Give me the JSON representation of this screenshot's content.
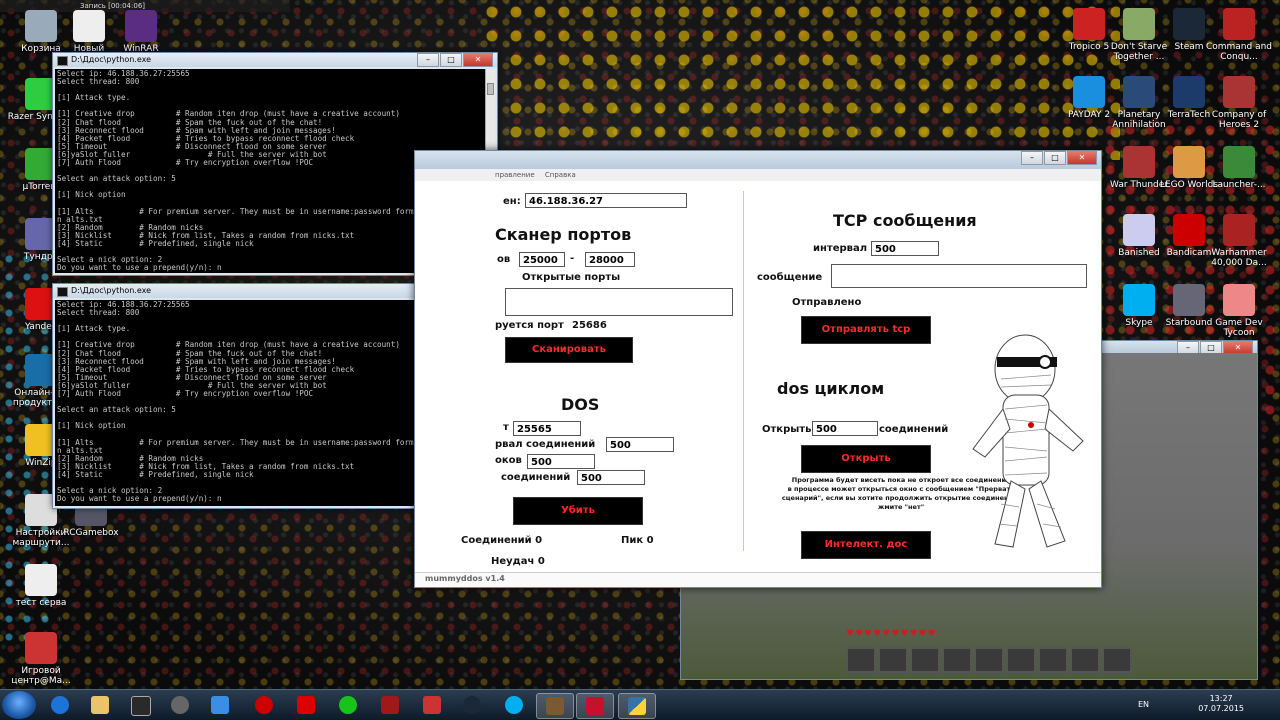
{
  "top_bar": {
    "recording_label": "Запись [00:04:06]"
  },
  "desktop_left_icons": [
    {
      "label": "Корзина"
    },
    {
      "label": "Новый"
    },
    {
      "label": "WinRAR"
    },
    {
      "label": "Razer Synapse"
    },
    {
      "label": "µTorrent"
    },
    {
      "label": "Тундра"
    },
    {
      "label": "Yandex"
    },
    {
      "label": "Онлайн-р... продукта ..."
    },
    {
      "label": "WinZip"
    },
    {
      "label": "Настройки маршрути..."
    },
    {
      "label": "RCGamebox"
    },
    {
      "label": "тест серва"
    },
    {
      "label": "Игровой центр@Ma..."
    }
  ],
  "desktop_right_icons": [
    {
      "label": "Tropico 5"
    },
    {
      "label": "Don't Starve Together ..."
    },
    {
      "label": "Steam"
    },
    {
      "label": "Command and Conqu..."
    },
    {
      "label": "PAYDAY 2"
    },
    {
      "label": "Planetary Annihilation"
    },
    {
      "label": "TerraTech"
    },
    {
      "label": "Company of Heroes 2"
    },
    {
      "label": "War Thunder"
    },
    {
      "label": "LEGO Worlds"
    },
    {
      "label": "Launcher-..."
    },
    {
      "label": "Banished"
    },
    {
      "label": "Bandicam"
    },
    {
      "label": "Warhammer 40,000 Da..."
    },
    {
      "label": "Skype"
    },
    {
      "label": "Starbound"
    },
    {
      "label": "Game Dev Tycoon"
    }
  ],
  "console1": {
    "title": "D:\\Ддос\\python.exe",
    "text": "Select ip: 46.188.36.27:25565\nSelect thread: 800\n\n[i] Attack type.\n\n[1] Creative drop         # Random iten drop (must have a creative account)\n[2] Chat flood            # Spam the fuck out of the chat!\n[3] Reconnect flood       # Spam with left and join messages!\n[4] Packet flood          # Tries to bypass reconnect flood check\n[5] Timeout               # Disconnect flood on some server\n[6]уaSlot fuller                 # Full the server with bot\n[7] Auth Flood            # Try encryption overflow !POC\n\nSelect an attack option: 5\n\n[i] Nick option\n\n[1] Alts          # For premium server. They must be in username:password format i\nn alts.txt\n[2] Random        # Random nicks\n[3] Nicklist      # Nick from list, Takes a random from nicks.txt\n[4] Static        # Predefined, single nick\n\nSelect a nick option: 2\nDo you want to use a prepend(y/n): n"
  },
  "console2": {
    "title": "D:\\Ддос\\python.exe",
    "text": "Select ip: 46.188.36.27:25565\nSelect thread: 800\n\n[i] Attack type.\n\n[1] Creative drop         # Random iten drop (must have a creative account)\n[2] Chat flood            # Spam the fuck out of the chat!\n[3] Reconnect flood       # Spam with left and join messages!\n[4] Packet flood          # Tries to bypass reconnect flood check\n[5] Timeout               # Disconnect flood on some server\n[6]уaSlot fuller                 # Full the server with bot\n[7] Auth Flood            # Try encryption overflow !POC\n\nSelect an attack option: 5\n\n[i] Nick option\n\n[1] Alts          # For premium server. They must be in username:password format i\nn alts.txt\n[2] Random        # Random nicks\n[3] Nicklist      # Nick from list, Takes a random from nicks.txt\n[4] Static        # Predefined, single nick\n\nSelect a nick option: 2\nDo you want to use a prepend(y/n): n"
  },
  "app": {
    "menu": [
      "правление",
      "Справка"
    ],
    "ip_label": "ен:",
    "ip_value": "46.188.36.27",
    "scanner_title": "Сканер портов",
    "range_label": "ов",
    "range_from": "25000",
    "range_dash": "-",
    "range_to": "28000",
    "open_ports_label": "Открытые порты",
    "open_ports_value": "",
    "current_port_label": "руется порт",
    "current_port_value": "25686",
    "scan_button": "Сканировать",
    "dos_title": "DOS",
    "port_label": "т",
    "port_value": "25565",
    "interval_label": "рвал соединений",
    "interval_value": "500",
    "threads_label": "оков",
    "threads_value": "500",
    "conn_label": "соединений",
    "conn_value": "500",
    "kill_button": "Убить",
    "connections_label": "Соединений 0",
    "peak_label": "Пик 0",
    "fails_label": "Неудач 0",
    "tcp_title": "TCP сообщения",
    "tcp_interval_label": "интервал",
    "tcp_interval_value": "500",
    "tcp_message_label": "сообщение",
    "tcp_message_value": "",
    "tcp_sent_label": "Отправлено",
    "tcp_send_button": "Отправлять tcp",
    "dos_loop_title": "dos циклом",
    "open_label": "Открыть",
    "open_value": "500",
    "open_suffix": "соединений",
    "open_button": "Открыть",
    "note": "Программа будет висеть пока не откроет все соединения\nв процессе может открыться окно с сообщением \"Прервать\nсценарий\", если вы хотите продолжить открытие соединений,\nжмите \"нет\"",
    "intel_button": "Интелект. дос",
    "version": "mummyddos v1.4"
  },
  "taskbar": {
    "lang": "EN",
    "time": "13:27",
    "date": "07.07.2015"
  },
  "colors": {
    "button_bg": "#000000",
    "button_text": "#ff2a2a",
    "separator": "#f3c46b"
  }
}
